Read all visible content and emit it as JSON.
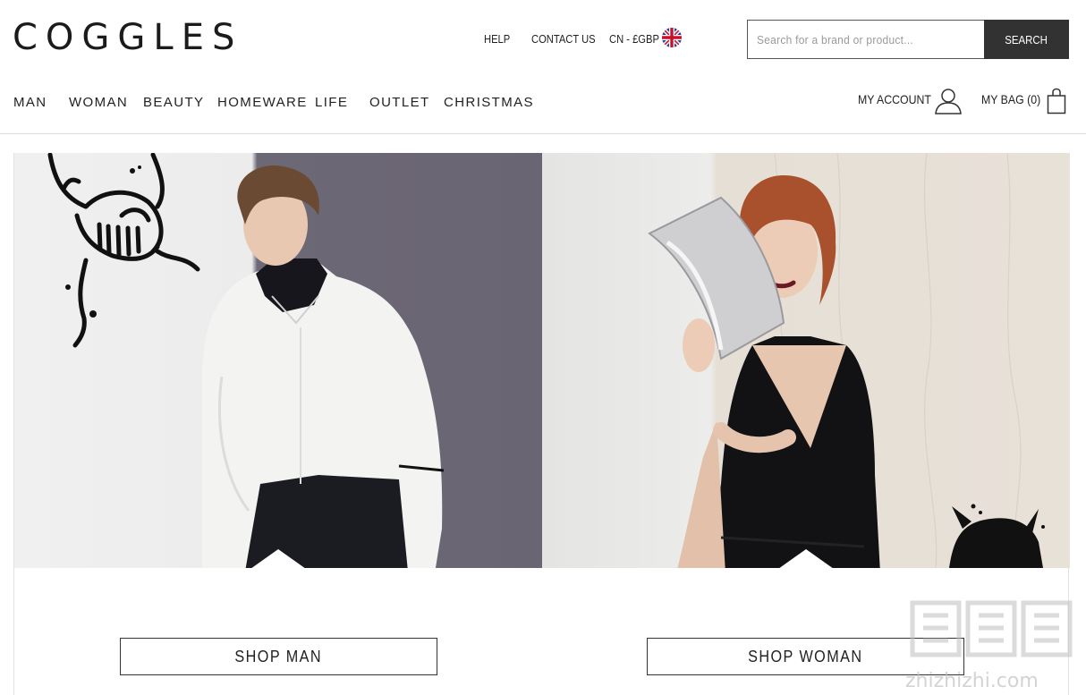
{
  "header": {
    "logo": "COGGLES",
    "help": "HELP",
    "contact": "CONTACT US",
    "currency": "CN - £GBP",
    "search_placeholder": "Search for a brand or product...",
    "search_button": "SEARCH"
  },
  "nav": {
    "items": [
      "MAN",
      "WOMAN",
      "BEAUTY",
      "HOMEWARE",
      "LIFE",
      "OUTLET",
      "CHRISTMAS"
    ]
  },
  "account": {
    "label": "MY ACCOUNT",
    "bag_label": "MY BAG (0)"
  },
  "hero": {
    "shop_man": "SHOP MAN",
    "shop_woman": "SHOP WOMAN"
  },
  "watermark": {
    "text": "zhizhizhi.com"
  },
  "colors": {
    "search_button_bg": "#323232",
    "man_backdrop": "#6a6573",
    "woman_backdrop": "#e8e1d8"
  }
}
